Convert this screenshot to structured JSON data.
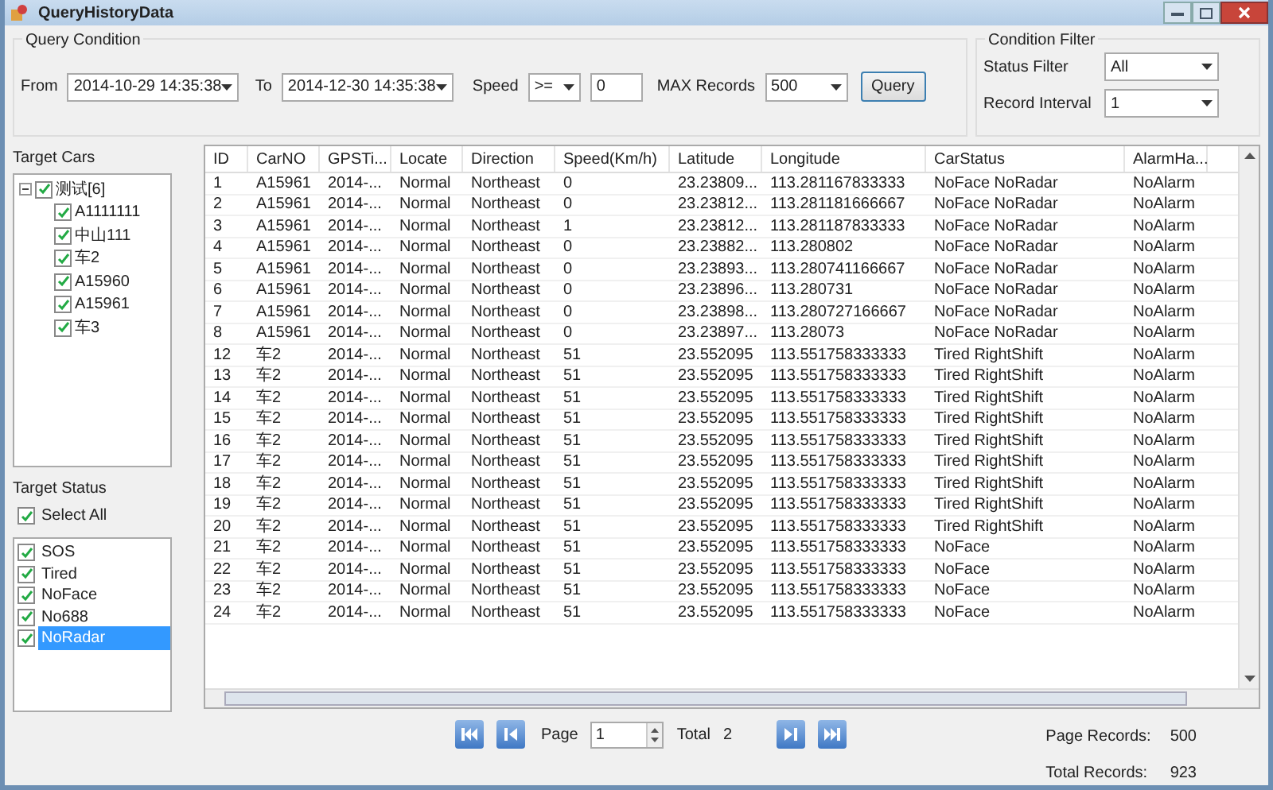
{
  "window": {
    "title": "QueryHistoryData"
  },
  "query_condition": {
    "title": "Query Condition",
    "from_label": "From",
    "from_value": "2014-10-29 14:35:38",
    "to_label": "To",
    "to_value": "2014-12-30 14:35:38",
    "speed_label": "Speed",
    "speed_operator": ">=",
    "speed_value": "0",
    "max_label": "MAX Records",
    "max_value": "500",
    "query_button": "Query"
  },
  "condition_filter": {
    "title": "Condition Filter",
    "status_label": "Status Filter",
    "status_value": "All",
    "interval_label": "Record Interval",
    "interval_value": "1"
  },
  "target_cars": {
    "title": "Target Cars",
    "tree": [
      {
        "label": "测试[6]",
        "checked": true,
        "expanded": true,
        "children": [
          {
            "label": "A1111111",
            "checked": true
          },
          {
            "label": "中山111",
            "checked": true
          },
          {
            "label": "车2",
            "checked": true
          },
          {
            "label": "A15960",
            "checked": true
          },
          {
            "label": "A15961",
            "checked": true
          },
          {
            "label": "车3",
            "checked": true
          }
        ]
      }
    ]
  },
  "target_status": {
    "title": "Target Status",
    "select_all": {
      "label": "Select All",
      "checked": true
    },
    "items": [
      {
        "label": "SOS",
        "checked": true,
        "selected": false
      },
      {
        "label": "Tired",
        "checked": true,
        "selected": false
      },
      {
        "label": "NoFace",
        "checked": true,
        "selected": false
      },
      {
        "label": "No688",
        "checked": true,
        "selected": false
      },
      {
        "label": "NoRadar",
        "checked": true,
        "selected": true
      }
    ]
  },
  "table": {
    "columns": [
      "ID",
      "CarNO",
      "GPSTi...",
      "Locate",
      "Direction",
      "Speed(Km/h)",
      "Latitude",
      "Longitude",
      "CarStatus",
      "AlarmHa..."
    ],
    "rows": [
      [
        "1",
        "A15961",
        "2014-...",
        "Normal",
        "Northeast",
        "0",
        "23.23809...",
        "113.281167833333",
        "NoFace NoRadar",
        "NoAlarm"
      ],
      [
        "2",
        "A15961",
        "2014-...",
        "Normal",
        "Northeast",
        "0",
        "23.23812...",
        "113.281181666667",
        "NoFace NoRadar",
        "NoAlarm"
      ],
      [
        "3",
        "A15961",
        "2014-...",
        "Normal",
        "Northeast",
        "1",
        "23.23812...",
        "113.281187833333",
        "NoFace NoRadar",
        "NoAlarm"
      ],
      [
        "4",
        "A15961",
        "2014-...",
        "Normal",
        "Northeast",
        "0",
        "23.23882...",
        "113.280802",
        "NoFace NoRadar",
        "NoAlarm"
      ],
      [
        "5",
        "A15961",
        "2014-...",
        "Normal",
        "Northeast",
        "0",
        "23.23893...",
        "113.280741166667",
        "NoFace NoRadar",
        "NoAlarm"
      ],
      [
        "6",
        "A15961",
        "2014-...",
        "Normal",
        "Northeast",
        "0",
        "23.23896...",
        "113.280731",
        "NoFace NoRadar",
        "NoAlarm"
      ],
      [
        "7",
        "A15961",
        "2014-...",
        "Normal",
        "Northeast",
        "0",
        "23.23898...",
        "113.280727166667",
        "NoFace NoRadar",
        "NoAlarm"
      ],
      [
        "8",
        "A15961",
        "2014-...",
        "Normal",
        "Northeast",
        "0",
        "23.23897...",
        "113.28073",
        "NoFace NoRadar",
        "NoAlarm"
      ],
      [
        "12",
        "车2",
        "2014-...",
        "Normal",
        "Northeast",
        "51",
        "23.552095",
        "113.551758333333",
        "Tired RightShift",
        "NoAlarm"
      ],
      [
        "13",
        "车2",
        "2014-...",
        "Normal",
        "Northeast",
        "51",
        "23.552095",
        "113.551758333333",
        "Tired RightShift",
        "NoAlarm"
      ],
      [
        "14",
        "车2",
        "2014-...",
        "Normal",
        "Northeast",
        "51",
        "23.552095",
        "113.551758333333",
        "Tired RightShift",
        "NoAlarm"
      ],
      [
        "15",
        "车2",
        "2014-...",
        "Normal",
        "Northeast",
        "51",
        "23.552095",
        "113.551758333333",
        "Tired RightShift",
        "NoAlarm"
      ],
      [
        "16",
        "车2",
        "2014-...",
        "Normal",
        "Northeast",
        "51",
        "23.552095",
        "113.551758333333",
        "Tired RightShift",
        "NoAlarm"
      ],
      [
        "17",
        "车2",
        "2014-...",
        "Normal",
        "Northeast",
        "51",
        "23.552095",
        "113.551758333333",
        "Tired RightShift",
        "NoAlarm"
      ],
      [
        "18",
        "车2",
        "2014-...",
        "Normal",
        "Northeast",
        "51",
        "23.552095",
        "113.551758333333",
        "Tired RightShift",
        "NoAlarm"
      ],
      [
        "19",
        "车2",
        "2014-...",
        "Normal",
        "Northeast",
        "51",
        "23.552095",
        "113.551758333333",
        "Tired RightShift",
        "NoAlarm"
      ],
      [
        "20",
        "车2",
        "2014-...",
        "Normal",
        "Northeast",
        "51",
        "23.552095",
        "113.551758333333",
        "Tired RightShift",
        "NoAlarm"
      ],
      [
        "21",
        "车2",
        "2014-...",
        "Normal",
        "Northeast",
        "51",
        "23.552095",
        "113.551758333333",
        "NoFace",
        "NoAlarm"
      ],
      [
        "22",
        "车2",
        "2014-...",
        "Normal",
        "Northeast",
        "51",
        "23.552095",
        "113.551758333333",
        "NoFace",
        "NoAlarm"
      ],
      [
        "23",
        "车2",
        "2014-...",
        "Normal",
        "Northeast",
        "51",
        "23.552095",
        "113.551758333333",
        "NoFace",
        "NoAlarm"
      ],
      [
        "24",
        "车2",
        "2014-...",
        "Normal",
        "Northeast",
        "51",
        "23.552095",
        "113.551758333333",
        "NoFace",
        "NoAlarm"
      ]
    ]
  },
  "pager": {
    "page_label": "Page",
    "page_value": "1",
    "total_label": "Total",
    "total_value": "2",
    "page_records_label": "Page Records:",
    "page_records_value": "500",
    "total_records_label": "Total Records:",
    "total_records_value": "923"
  }
}
